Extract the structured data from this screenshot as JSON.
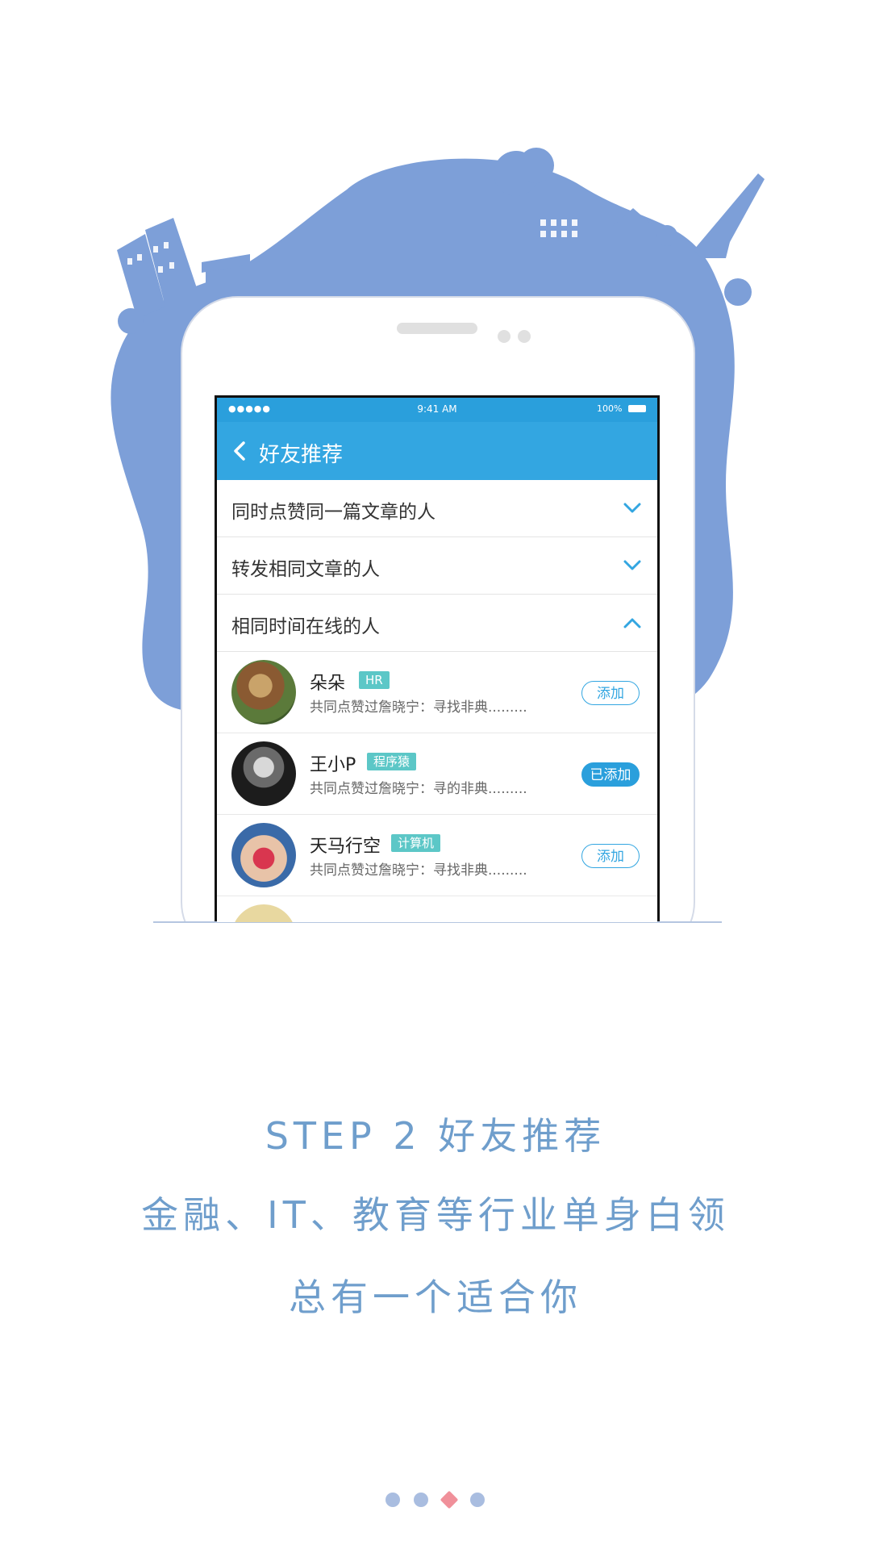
{
  "status_bar": {
    "signal": "●●●●●",
    "time": "9:41 AM",
    "battery": "100%"
  },
  "nav": {
    "title": "好友推荐"
  },
  "sections": [
    {
      "label": "同时点赞同一篇文章的人",
      "expanded": false
    },
    {
      "label": "转发相同文章的人",
      "expanded": false
    },
    {
      "label": "相同时间在线的人",
      "expanded": true
    }
  ],
  "friends": [
    {
      "name": "朵朵",
      "tag": "HR",
      "desc": "共同点赞过詹晓宁：寻找非典.........",
      "button": "添加",
      "added": false
    },
    {
      "name": "王小P",
      "tag": "程序猿",
      "desc": "共同点赞过詹晓宁：寻的非典.........",
      "button": "已添加",
      "added": true
    },
    {
      "name": "天马行空",
      "tag": "计算机",
      "desc": "共同点赞过詹晓宁：寻找非典.........",
      "button": "添加",
      "added": false
    }
  ],
  "caption": {
    "line1": "STEP 2 好友推荐",
    "line2": "金融、IT、教育等行业单身白领",
    "line3": "总有一个适合你"
  },
  "pager": {
    "count": 4,
    "active_index": 2
  },
  "colors": {
    "accent": "#33a6e1",
    "blob": "#7d9fd8",
    "caption": "#6f9ecc",
    "dot": "#a9bde0",
    "dot_active": "#f0909a"
  }
}
